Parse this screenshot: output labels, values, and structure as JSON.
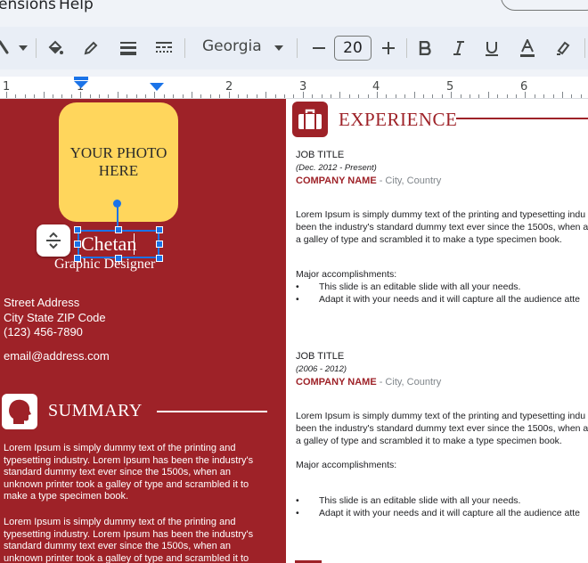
{
  "menu": {
    "extensions": "ensions",
    "help": "Help"
  },
  "toolbar": {
    "font": "Georgia",
    "font_size": "20"
  },
  "ruler": {
    "numbers": [
      "1",
      "1",
      "2",
      "3",
      "4",
      "5",
      "6"
    ]
  },
  "sidebar": {
    "photo_line1": "YOUR PHOTO",
    "photo_line2": "HERE",
    "name": "Chetan",
    "role": "Graphic Designer",
    "street": "Street Address",
    "city": "City State ZIP Code",
    "phone": "(123) 456-7890",
    "email": "email@address.com",
    "summary_title": "SUMMARY",
    "summary_para1": [
      "Lorem Ipsum is simply dummy text of the printing and",
      "typesetting industry. Lorem Ipsum has been the industry's",
      "standard dummy text ever since the 1500s, when an",
      "unknown printer took a galley of type and scrambled it to",
      "make a type specimen book."
    ],
    "summary_para2": [
      "Lorem Ipsum is simply dummy text of the printing and",
      "typesetting industry. Lorem Ipsum has been the industry's",
      "standard dummy text ever since the 1500s, when an",
      "unknown printer took a galley of type and scrambled it to"
    ]
  },
  "experience": {
    "title": "EXPERIENCE",
    "jobs": [
      {
        "title": "JOB TITLE",
        "dates": "(Dec. 2012 - Present)",
        "company": "COMPANY NAME",
        "location": " - City, Country",
        "desc": [
          "Lorem Ipsum is simply dummy text of the printing and typesetting indu",
          "been the industry's standard dummy text ever since the 1500s, when a",
          "a galley of type and scrambled it to make a type specimen book."
        ],
        "acc_label": "Major accomplishments:",
        "bullets": [
          "This slide is an editable slide with all your needs.",
          "Adapt it with your needs and it will capture all the audience atte"
        ]
      },
      {
        "title": "JOB TITLE",
        "dates": "(2006 - 2012)",
        "company": "COMPANY NAME",
        "location": " - City, Country",
        "desc": [
          "Lorem Ipsum is simply dummy text of the printing and typesetting indu",
          "been the industry's standard dummy text ever since the 1500s, when a",
          "a galley of type and scrambled it to make a type specimen book."
        ],
        "acc_label": "Major accomplishments:",
        "bullets": [
          "This slide is an editable slide with all your needs.",
          "Adapt it with your needs and it will capture all the audience atte"
        ]
      }
    ]
  },
  "colors": {
    "accent": "#9e2228",
    "photo": "#ffd65c",
    "selection": "#1a73e8"
  }
}
